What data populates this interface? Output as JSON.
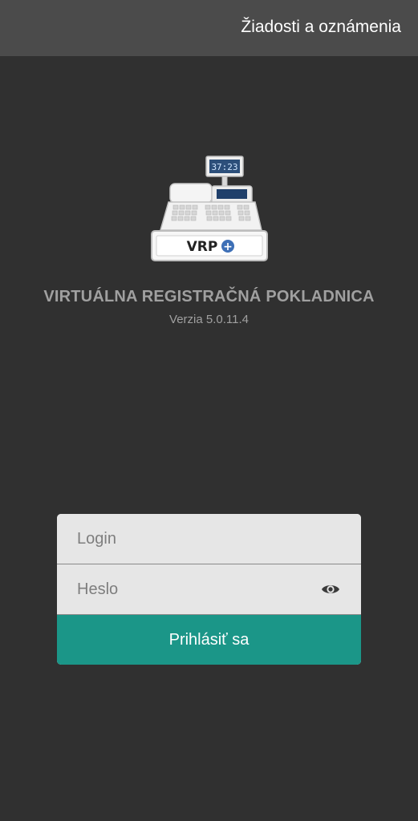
{
  "topbar": {
    "link_label": "Žiadosti a oznámenia"
  },
  "logo": {
    "display_time": "37:23",
    "brand": "VRP",
    "brand_plus": "+"
  },
  "app": {
    "title": "VIRTUÁLNA REGISTRAČNÁ POKLADNICA",
    "version": "Verzia 5.0.11.4"
  },
  "login": {
    "login_placeholder": "Login",
    "login_value": "",
    "password_placeholder": "Heslo",
    "password_value": "",
    "eye_icon": "eye-icon",
    "submit_label": "Prihlásiť sa"
  },
  "colors": {
    "background": "#303030",
    "topbar": "#4b4b4b",
    "accent": "#1b9688",
    "field": "#e6e6e6",
    "muted_text": "#a0a0a0"
  }
}
